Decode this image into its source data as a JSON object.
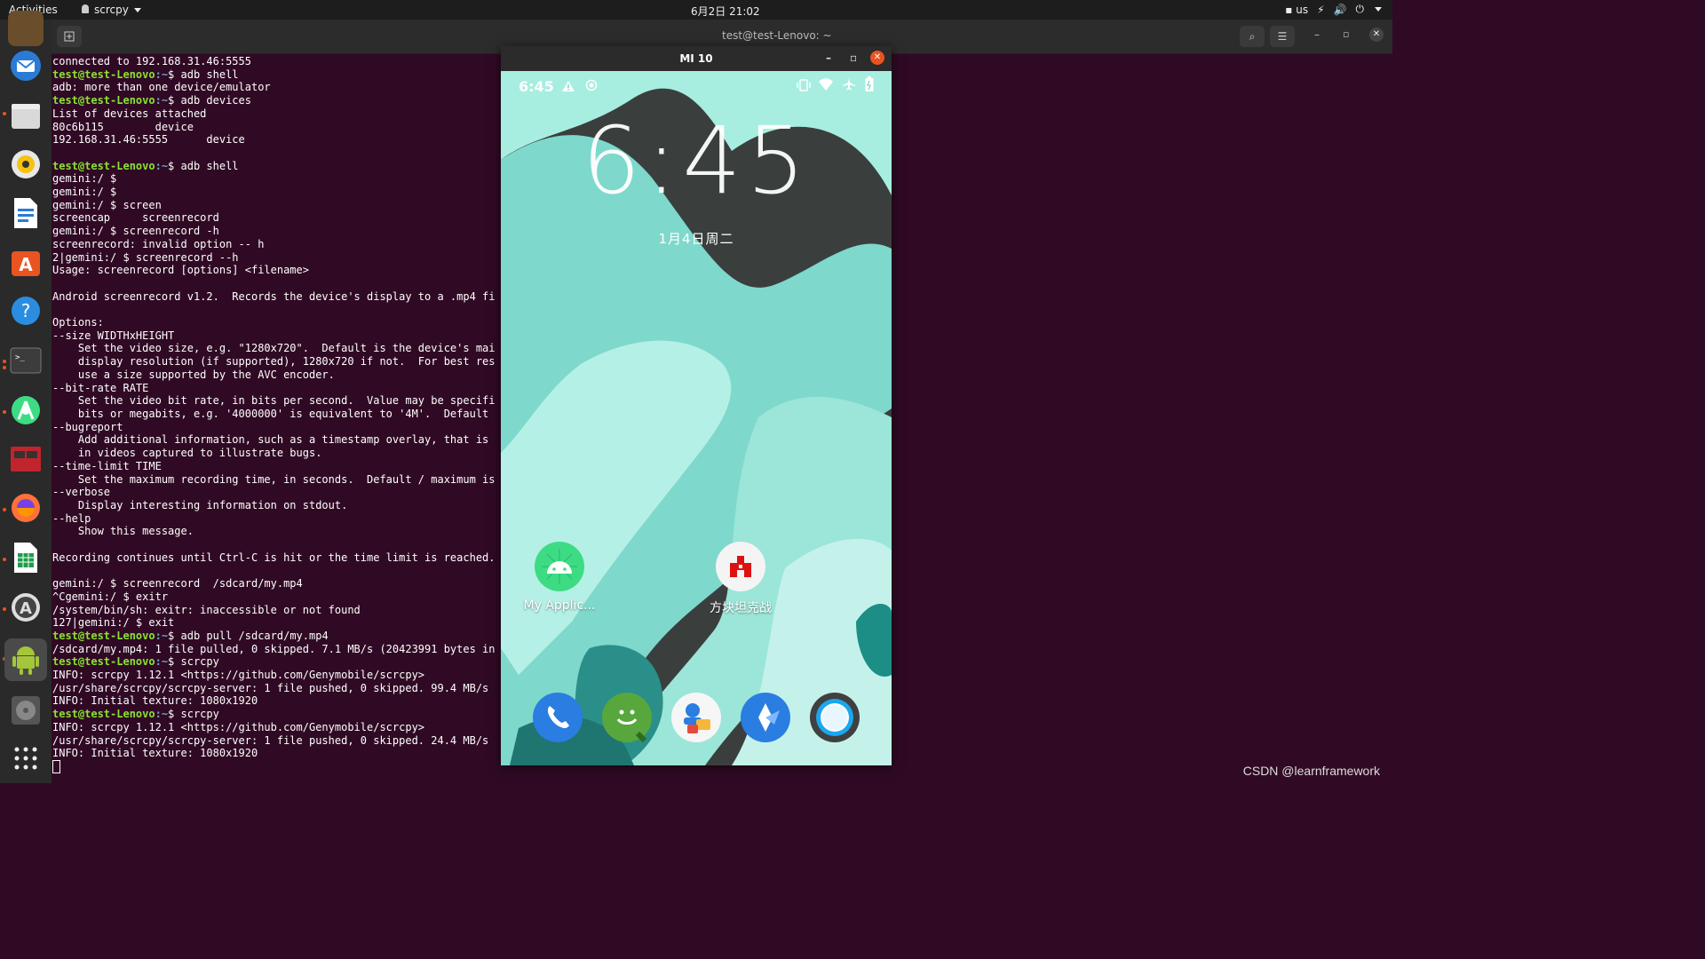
{
  "topbar": {
    "activities": "Activities",
    "app_name": "scrcpy",
    "clock": "6月2日 21:02",
    "keyboard": "us"
  },
  "terminal": {
    "title": "test@test-Lenovo: ~",
    "lines": [
      {
        "t": "out",
        "text": "connected to 192.168.31.46:5555"
      },
      {
        "t": "prompt",
        "user": "test@test-Lenovo",
        "path": ":~",
        "cmd": "$ adb shell"
      },
      {
        "t": "out",
        "text": "adb: more than one device/emulator"
      },
      {
        "t": "prompt",
        "user": "test@test-Lenovo",
        "path": ":~",
        "cmd": "$ adb devices"
      },
      {
        "t": "out",
        "text": "List of devices attached"
      },
      {
        "t": "out",
        "text": "80c6b115        device"
      },
      {
        "t": "out",
        "text": "192.168.31.46:5555      device"
      },
      {
        "t": "out",
        "text": ""
      },
      {
        "t": "prompt",
        "user": "test@test-Lenovo",
        "path": ":~",
        "cmd": "$ adb shell"
      },
      {
        "t": "out",
        "text": "gemini:/ $"
      },
      {
        "t": "out",
        "text": "gemini:/ $"
      },
      {
        "t": "out",
        "text": "gemini:/ $ screen"
      },
      {
        "t": "out",
        "text": "screencap     screenrecord"
      },
      {
        "t": "out",
        "text": "gemini:/ $ screenrecord -h"
      },
      {
        "t": "out",
        "text": "screenrecord: invalid option -- h"
      },
      {
        "t": "out",
        "text": "2|gemini:/ $ screenrecord --h"
      },
      {
        "t": "out",
        "text": "Usage: screenrecord [options] <filename>"
      },
      {
        "t": "out",
        "text": ""
      },
      {
        "t": "out",
        "text": "Android screenrecord v1.2.  Records the device's display to a .mp4 fi"
      },
      {
        "t": "out",
        "text": ""
      },
      {
        "t": "out",
        "text": "Options:"
      },
      {
        "t": "out",
        "text": "--size WIDTHxHEIGHT"
      },
      {
        "t": "out",
        "text": "    Set the video size, e.g. \"1280x720\".  Default is the device's mai"
      },
      {
        "t": "out",
        "text": "    display resolution (if supported), 1280x720 if not.  For best res"
      },
      {
        "t": "out",
        "text": "    use a size supported by the AVC encoder."
      },
      {
        "t": "out",
        "text": "--bit-rate RATE"
      },
      {
        "t": "out",
        "text": "    Set the video bit rate, in bits per second.  Value may be specifi"
      },
      {
        "t": "out",
        "text": "    bits or megabits, e.g. '4000000' is equivalent to '4M'.  Default"
      },
      {
        "t": "out",
        "text": "--bugreport"
      },
      {
        "t": "out",
        "text": "    Add additional information, such as a timestamp overlay, that is"
      },
      {
        "t": "out",
        "text": "    in videos captured to illustrate bugs."
      },
      {
        "t": "out",
        "text": "--time-limit TIME"
      },
      {
        "t": "out",
        "text": "    Set the maximum recording time, in seconds.  Default / maximum is"
      },
      {
        "t": "out",
        "text": "--verbose"
      },
      {
        "t": "out",
        "text": "    Display interesting information on stdout."
      },
      {
        "t": "out",
        "text": "--help"
      },
      {
        "t": "out",
        "text": "    Show this message."
      },
      {
        "t": "out",
        "text": ""
      },
      {
        "t": "out",
        "text": "Recording continues until Ctrl-C is hit or the time limit is reached."
      },
      {
        "t": "out",
        "text": ""
      },
      {
        "t": "out",
        "text": "gemini:/ $ screenrecord  /sdcard/my.mp4"
      },
      {
        "t": "out",
        "text": "^Cgemini:/ $ exitr"
      },
      {
        "t": "out",
        "text": "/system/bin/sh: exitr: inaccessible or not found"
      },
      {
        "t": "out",
        "text": "127|gemini:/ $ exit"
      },
      {
        "t": "prompt",
        "user": "test@test-Lenovo",
        "path": ":~",
        "cmd": "$ adb pull /sdcard/my.mp4"
      },
      {
        "t": "out",
        "text": "/sdcard/my.mp4: 1 file pulled, 0 skipped. 7.1 MB/s (20423991 bytes in"
      },
      {
        "t": "prompt",
        "user": "test@test-Lenovo",
        "path": ":~",
        "cmd": "$ scrcpy"
      },
      {
        "t": "out",
        "text": "INFO: scrcpy 1.12.1 <https://github.com/Genymobile/scrcpy>"
      },
      {
        "t": "out",
        "text": "/usr/share/scrcpy/scrcpy-server: 1 file pushed, 0 skipped. 99.4 MB/s"
      },
      {
        "t": "out",
        "text": "INFO: Initial texture: 1080x1920"
      },
      {
        "t": "prompt",
        "user": "test@test-Lenovo",
        "path": ":~",
        "cmd": "$ scrcpy"
      },
      {
        "t": "out",
        "text": "INFO: scrcpy 1.12.1 <https://github.com/Genymobile/scrcpy>"
      },
      {
        "t": "out",
        "text": "/usr/share/scrcpy/scrcpy-server: 1 file pushed, 0 skipped. 24.4 MB/s"
      },
      {
        "t": "out",
        "text": "INFO: Initial texture: 1080x1920"
      }
    ]
  },
  "phone": {
    "window_title": "MI 10",
    "status_time": "6:45",
    "clock_big": "6:45",
    "date": "1月4日周二",
    "apps": [
      {
        "label": "My Applic..."
      },
      {
        "label": "方块坦克战"
      }
    ],
    "dock": [
      "phone-icon",
      "messages-icon",
      "contacts-icon",
      "browser-icon",
      "camera-icon"
    ]
  },
  "watermark": "CSDN @learnframework",
  "colors": {
    "prompt_green": "#8ae234",
    "prompt_path": "#729fcf",
    "terminal_bg": "#300a24",
    "ubuntu_orange": "#e95420"
  }
}
